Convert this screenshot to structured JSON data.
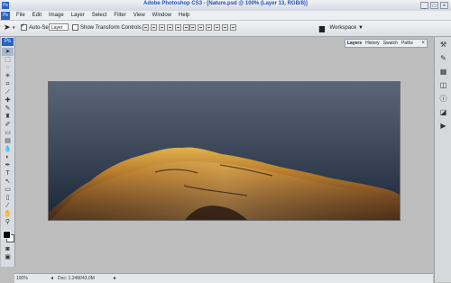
{
  "window": {
    "title": "Adobe Photoshop CS3 - [Nature.psd @ 100% (Layer 13, RGB/8)]",
    "app_badge": "Ps",
    "controls": [
      "_",
      "□",
      "×"
    ]
  },
  "menu": {
    "badge": "Ps",
    "items": [
      "File",
      "Edit",
      "Image",
      "Layer",
      "Select",
      "Filter",
      "View",
      "Window",
      "Help"
    ]
  },
  "options": {
    "auto_select_label": "Auto-Select:",
    "auto_select_value": "Layer",
    "show_transform_label": "Show Transform Controls",
    "workspace_label": "Workspace ▼"
  },
  "layers_panel": {
    "tabs": [
      "Layers",
      "History",
      "Swatch",
      "Paths"
    ],
    "close": "×"
  },
  "status": {
    "zoom": "100%",
    "doc": "Doc: 1.24M/43.0M"
  },
  "icons": {
    "tools": [
      "move",
      "marquee",
      "lasso",
      "magic-wand",
      "crop",
      "slice",
      "healing",
      "brush",
      "stamp",
      "history-brush",
      "eraser",
      "gradient",
      "blur",
      "dodge",
      "pen",
      "type",
      "path-select",
      "shape",
      "notes",
      "eyedropper",
      "hand",
      "zoom"
    ],
    "right_panel": [
      "tools-icon",
      "brush-icon",
      "swatch-icon",
      "layers-icon",
      "info-icon",
      "navigator-icon",
      "actions-icon"
    ]
  }
}
